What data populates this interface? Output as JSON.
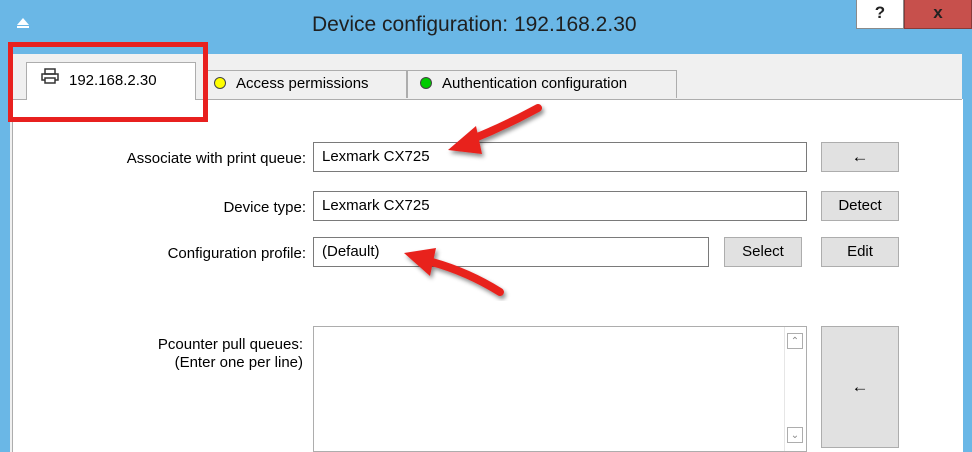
{
  "window": {
    "title": "Device configuration: 192.168.2.30",
    "help_label": "?",
    "close_label": "x"
  },
  "tabs": [
    {
      "label": "192.168.2.30",
      "icon": "printer-icon",
      "active": true
    },
    {
      "label": "Access permissions",
      "status_color": "#ffff00"
    },
    {
      "label": "Authentication configuration",
      "status_color": "#00cc00"
    }
  ],
  "form": {
    "print_queue_label": "Associate with print queue:",
    "print_queue_value": "Lexmark CX725",
    "print_queue_button": "←",
    "device_type_label": "Device type:",
    "device_type_value": "Lexmark CX725",
    "detect_button": "Detect",
    "config_profile_label": "Configuration profile:",
    "config_profile_value": "(Default)",
    "select_button": "Select",
    "edit_button": "Edit",
    "pull_queues_label_line1": "Pcounter pull queues:",
    "pull_queues_label_line2": "(Enter one per line)",
    "pull_queues_value": "",
    "pull_queues_button": "←"
  },
  "colors": {
    "title_bar": "#6ab7e6",
    "close_button": "#c7504c",
    "annotation": "#e8201f"
  }
}
